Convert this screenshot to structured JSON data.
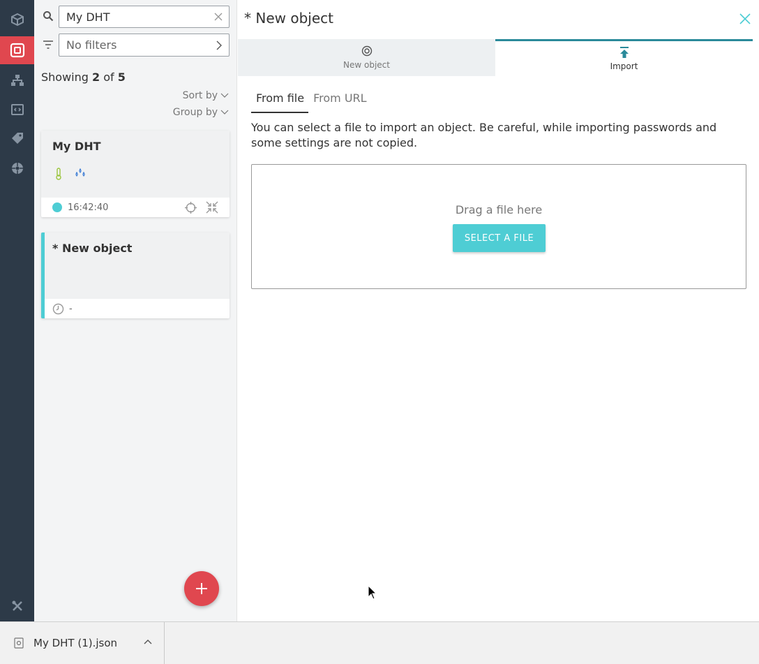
{
  "rail": {
    "items": [
      {
        "icon": "cube-icon"
      },
      {
        "icon": "object-icon",
        "active": true
      },
      {
        "icon": "hierarchy-icon"
      },
      {
        "icon": "code-icon"
      },
      {
        "icon": "tag-icon"
      },
      {
        "icon": "network-icon"
      }
    ],
    "bottom_icon": "tools-icon"
  },
  "list": {
    "search_value": "My DHT",
    "filter_value": "No filters",
    "showing_prefix": "Showing",
    "showing_count": "2",
    "showing_of": "of",
    "showing_total": "5",
    "sort_by": "Sort by",
    "group_by": "Group by",
    "cards": [
      {
        "title": "My DHT",
        "time": "16:42:40"
      },
      {
        "title": "* New object",
        "time": "-"
      }
    ]
  },
  "main": {
    "title": "* New object",
    "tabs": [
      {
        "label": "New object"
      },
      {
        "label": "Import"
      }
    ],
    "sub_tabs": [
      {
        "label": "From file"
      },
      {
        "label": "From URL"
      }
    ],
    "description": "You can select a file to import an object. Be careful, while importing passwords and some settings are not copied.",
    "drop_text": "Drag a file here",
    "select_button": "SELECT A FILE"
  },
  "download_bar": {
    "filename": "My DHT (1).json"
  },
  "colors": {
    "rail_bg": "#2d3a48",
    "rail_active": "#e0474f",
    "accent_teal": "#4ecdd4",
    "fab": "#e0474f"
  }
}
